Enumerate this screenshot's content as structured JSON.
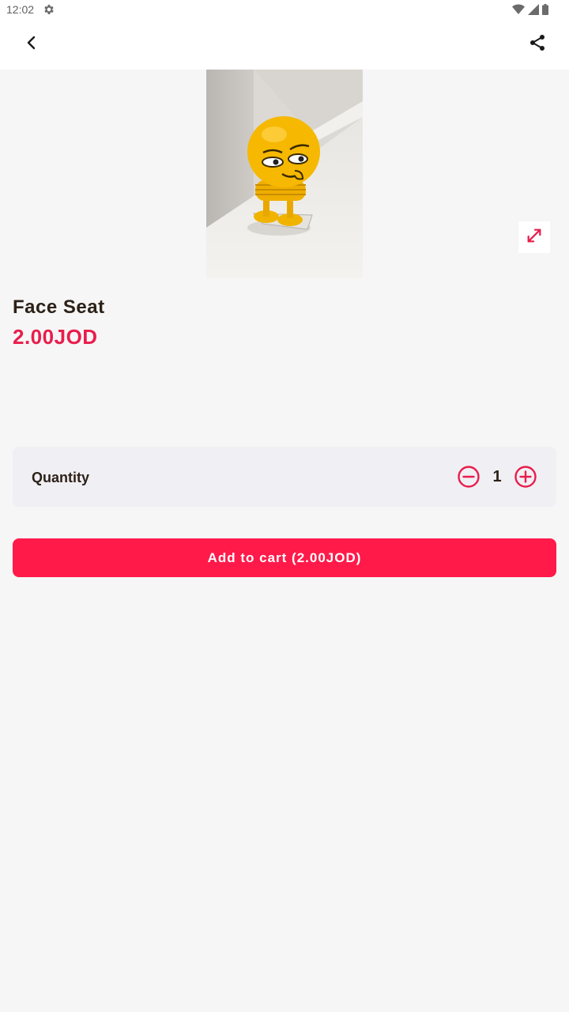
{
  "status_bar": {
    "time": "12:02",
    "icons": [
      "settings-gear-icon",
      "wifi-icon",
      "signal-icon",
      "battery-icon"
    ]
  },
  "app_bar": {
    "back_icon": "chevron-left-icon",
    "share_icon": "share-icon"
  },
  "product": {
    "name": "Face Seat",
    "price": "2.00JOD",
    "image_alt": "yellow emoji spring toy"
  },
  "quantity": {
    "label": "Quantity",
    "value": "1",
    "decrement_icon": "minus-circle-icon",
    "increment_icon": "plus-circle-icon"
  },
  "cart_button": {
    "label": "Add to cart (2.00JOD)"
  },
  "colors": {
    "accent": "#e91d4c",
    "button": "#ff1a4a",
    "background": "#f6f6f6",
    "card": "#f0eff4"
  }
}
